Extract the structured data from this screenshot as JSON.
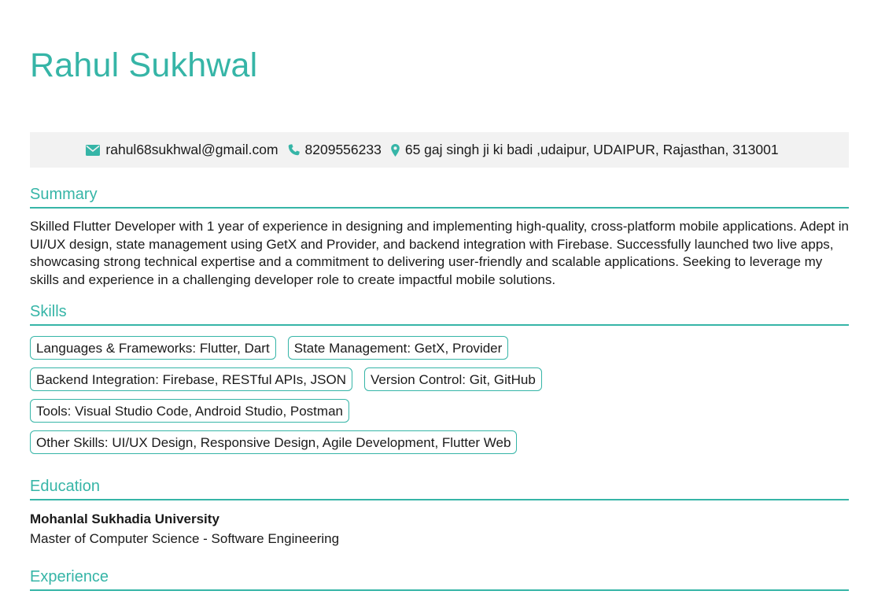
{
  "name": "Rahul Sukhwal",
  "contact": {
    "email": "rahul68sukhwal@gmail.com",
    "phone": "8209556233",
    "address": "65 gaj singh ji ki badi ,udaipur, UDAIPUR, Rajasthan, 313001",
    "icons": [
      "envelope-icon",
      "phone-icon",
      "map-marker-icon"
    ]
  },
  "colors": {
    "accent": "#36b5a7",
    "contact_bar_bg": "#f2f2f2",
    "text": "#1a1a1a"
  },
  "summary": {
    "title": "Summary",
    "text": "Skilled Flutter Developer with 1 year of experience in designing and implementing high-quality, cross-platform mobile applications. Adept in UI/UX design, state management using GetX and Provider, and backend integration with Firebase. Successfully launched two live apps, showcasing strong technical expertise and a commitment to delivering user-friendly and scalable applications. Seeking to leverage my skills and experience in a challenging developer role to create impactful mobile solutions."
  },
  "skills": {
    "title": "Skills",
    "items": [
      "Languages & Frameworks: Flutter, Dart",
      "State Management: GetX, Provider",
      "Backend Integration: Firebase, RESTful APIs, JSON",
      "Version Control: Git, GitHub",
      "Tools: Visual Studio Code, Android Studio, Postman",
      "Other Skills: UI/UX Design, Responsive Design, Agile Development, Flutter Web"
    ]
  },
  "education": {
    "title": "Education",
    "school": "Mohanlal Sukhadia University",
    "degree": "Master of Computer Science - Software Engineering"
  },
  "experience": {
    "title": "Experience"
  }
}
